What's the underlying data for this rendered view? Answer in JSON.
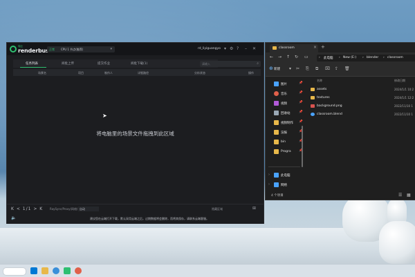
{
  "renderbus": {
    "brand_small": "瑞云",
    "brand": "renderbus",
    "mode_tag": "正常",
    "mode_text": "CPU 1 节点(推荐)",
    "user": "rd_liyiguangyo",
    "tabs": [
      {
        "label": "任务列表",
        "active": true
      },
      {
        "label": "阅批上传",
        "active": false
      },
      {
        "label": "提交作业",
        "active": false
      },
      {
        "label": "阅批下载(1)",
        "active": false
      }
    ],
    "search_placeholder": "请输入",
    "columns": [
      "场景名",
      "项目",
      "制作人",
      "详细路径",
      "分析状态",
      "操作"
    ],
    "dropzone_text": "将电脑里的场景文件拖拽到此区域",
    "footer": {
      "pager": "K < 1/1 > K",
      "raysync": "RaySync/Proxy(网络)",
      "select_value": "自动",
      "right_text": "隐藏区域",
      "notice": "建议您在云端打开下载，默认采用云端之后，过期数据将会删除，而将其保存，请联系云端客服。"
    }
  },
  "explorer": {
    "tab_title": "classroom",
    "breadcrumbs": [
      "此电脑",
      "New (E:)",
      "blender",
      "classroom"
    ],
    "new_label": "新建",
    "column_headers": {
      "name": "名称",
      "date": "修改日期"
    },
    "nav_items": [
      {
        "label": "图片",
        "color": "#4aa3ff",
        "pinned": true
      },
      {
        "label": "音乐",
        "color": "#e0604a",
        "pinned": true
      },
      {
        "label": "视频",
        "color": "#b35ad9",
        "pinned": true
      },
      {
        "label": "回收站",
        "color": "#9aa8b5",
        "pinned": true
      },
      {
        "label": "视频制作",
        "color": "#e8b84a",
        "pinned": true
      },
      {
        "label": "渲报",
        "color": "#e8b84a",
        "pinned": true
      },
      {
        "label": "bin",
        "color": "#e8b84a",
        "pinned": true
      },
      {
        "label": "Progra",
        "color": "#e8b84a",
        "pinned": true
      }
    ],
    "nav_bottom": [
      {
        "label": "此电脑",
        "color": "#4aa3ff"
      },
      {
        "label": "网络",
        "color": "#4aa3ff"
      }
    ],
    "files": [
      {
        "name": "assets",
        "date": "2024/1/1 10:2",
        "type": "folder"
      },
      {
        "name": "textures",
        "date": "2024/1/1 12:2",
        "type": "folder"
      },
      {
        "name": "background.png",
        "date": "2022/11/10 1",
        "type": "image"
      },
      {
        "name": "classroom.blend",
        "date": "2022/11/10 1",
        "type": "blend"
      }
    ],
    "status": "4 个项目"
  },
  "colors": {
    "accent_green": "#2fbf71",
    "folder": "#e8b84a"
  }
}
